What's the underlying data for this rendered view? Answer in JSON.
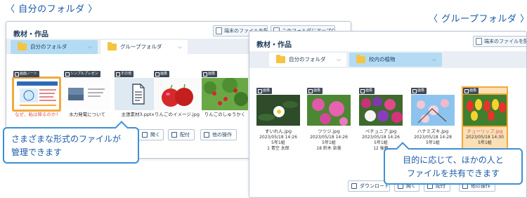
{
  "captions": {
    "left": "〈 自分のフォルダ 〉",
    "right": "〈 グループフォルダ 〉"
  },
  "left_window": {
    "title": "教材・作品",
    "toolbar": {
      "submit_device_file": "端末のファイルを配付",
      "upload_to_folder": "このフォルダにアップロード"
    },
    "tabs": [
      {
        "label": "自分のフォルダ",
        "active": true
      },
      {
        "label": "グループフォルダ",
        "active": false
      }
    ],
    "files": [
      {
        "badge": "画面ノート",
        "name": "なぜ、粘は降るのか?",
        "selected": true
      },
      {
        "badge": "シンプルプレゼン",
        "name": "水力発電について",
        "selected": false
      },
      {
        "badge": "その他",
        "name": "主張素材3.pptx",
        "selected": false,
        "placeholder": true
      },
      {
        "badge": "画像",
        "name": "りんごのイメージ.jpg",
        "selected": false
      },
      {
        "badge": "画像",
        "name": "りんごのしゅうかく",
        "selected": false
      }
    ],
    "actions": {
      "open": "開く",
      "distribute": "配付",
      "other_ops": "他の操作"
    }
  },
  "right_window": {
    "title": "教材・作品",
    "toolbar": {
      "submit_device_file": "端末のファイルを配付"
    },
    "tabs": [
      {
        "label": "自分のフォルダ",
        "active": false
      },
      {
        "label": "校内の植物",
        "active": true
      }
    ],
    "files": [
      {
        "badge": "画像",
        "name": "すいれん.jpg",
        "date": "2023/05/18 14:26",
        "class": "5年1組",
        "owner": "1 青空 太郎",
        "selected": false
      },
      {
        "badge": "画像",
        "name": "ツツジ.jpg",
        "date": "2023/05/18 14:26",
        "class": "5年1組",
        "owner": "18 鈴木 奈美",
        "selected": false
      },
      {
        "badge": "画像",
        "name": "ペチュニア.jpg",
        "date": "2023/05/18 14:26",
        "class": "5年1組",
        "owner": "12 後藤",
        "selected": false
      },
      {
        "badge": "画像",
        "name": "ハナミズキ.jpg",
        "date": "2023/05/18 14:28",
        "class": "5年1組",
        "owner": "",
        "selected": false
      },
      {
        "badge": "画像",
        "name": "チューリップ.jpg",
        "date": "2023/05/18 14:30",
        "class": "5年1組",
        "owner": "",
        "selected": true
      }
    ],
    "actions": {
      "download": "ダウンロード",
      "open": "開く",
      "distribute": "配付",
      "other_ops": "他の操作"
    }
  },
  "callouts": {
    "left_line1": "さまざまな形式のファイルが",
    "left_line2": "管理できます",
    "right_line1": "目的に応じて、ほかの人と",
    "right_line2": "ファイルを共有できます"
  },
  "colors": {
    "accent": "#3d8fd6",
    "active_tab": "#b3dcf4",
    "folder": "#f5c441",
    "selection": "#f3a93b"
  }
}
